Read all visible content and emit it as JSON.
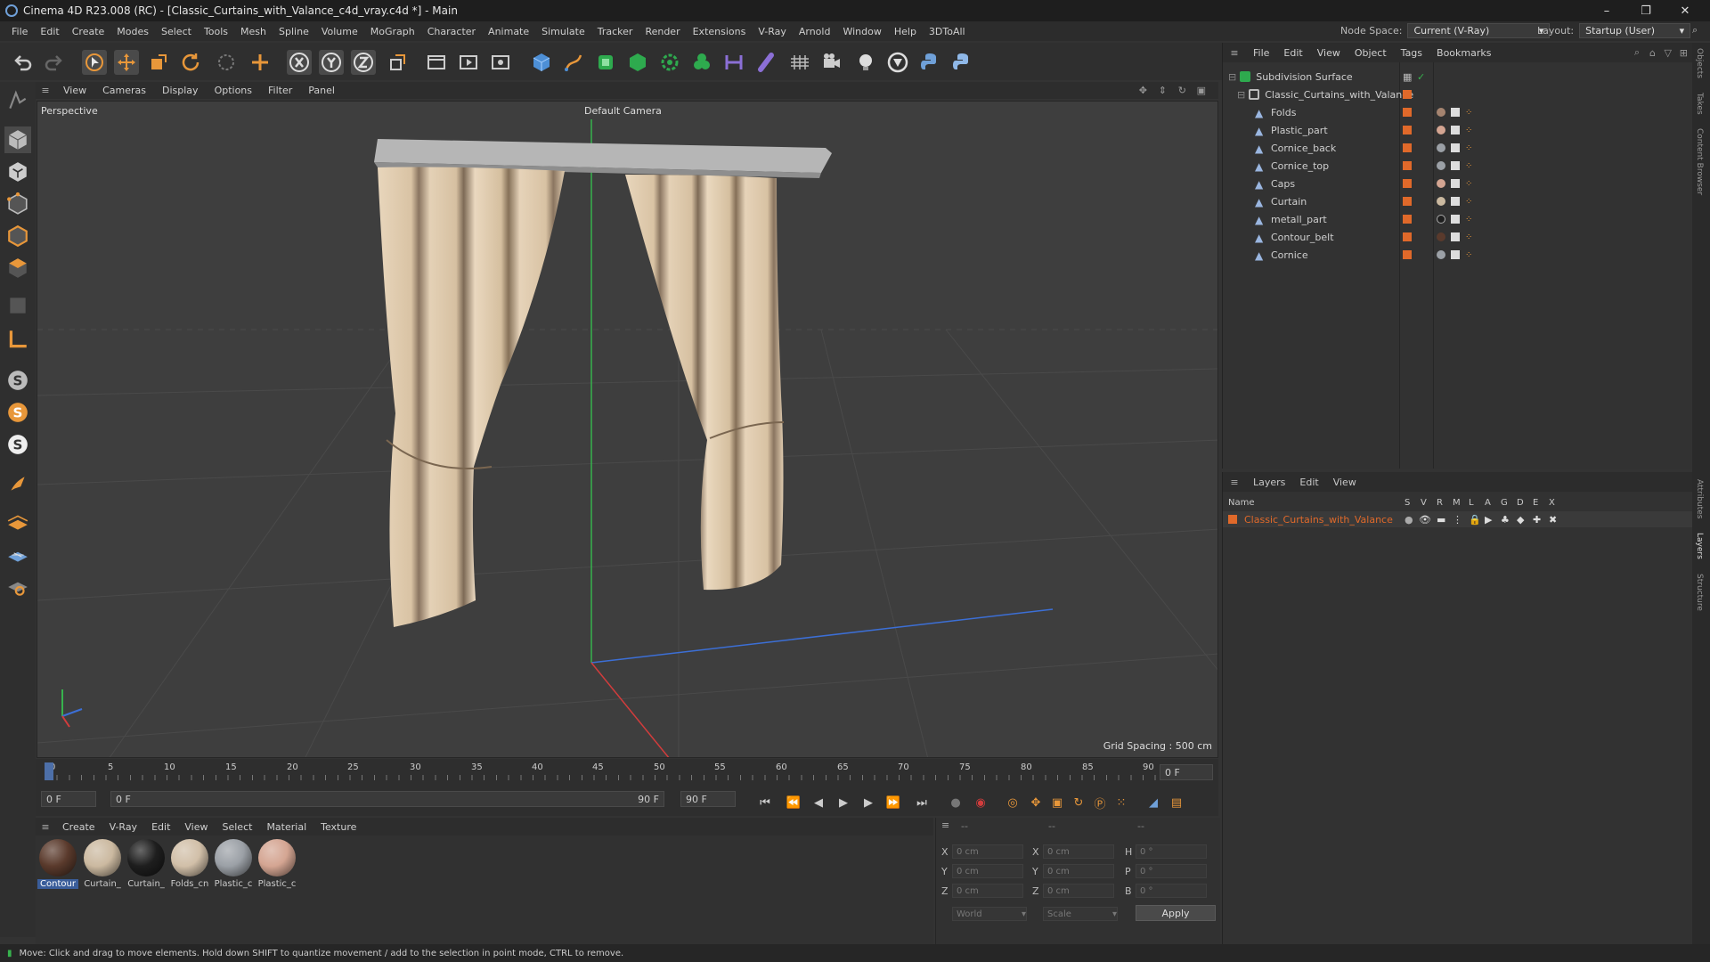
{
  "window": {
    "title": "Cinema 4D R23.008 (RC) - [Classic_Curtains_with_Valance_c4d_vray.c4d *] - Main",
    "controls": [
      "–",
      "❐",
      "✕"
    ]
  },
  "menubar": {
    "items": [
      "File",
      "Edit",
      "Create",
      "Modes",
      "Select",
      "Tools",
      "Mesh",
      "Spline",
      "Volume",
      "MoGraph",
      "Character",
      "Animate",
      "Simulate",
      "Tracker",
      "Render",
      "Extensions",
      "V-Ray",
      "Arnold",
      "Window",
      "Help",
      "3DToAll"
    ],
    "node_space_label": "Node Space:",
    "node_space_value": "Current (V-Ray)",
    "layout_label": "Layout:",
    "layout_value": "Startup (User)"
  },
  "viewport": {
    "menu": [
      "View",
      "Cameras",
      "Display",
      "Options",
      "Filter",
      "Panel"
    ],
    "view_name": "Perspective",
    "camera": "Default Camera",
    "grid_spacing": "Grid Spacing : 500 cm"
  },
  "timeline": {
    "ticks": [
      "0",
      "5",
      "10",
      "15",
      "20",
      "25",
      "30",
      "35",
      "40",
      "45",
      "50",
      "55",
      "60",
      "65",
      "70",
      "75",
      "80",
      "85",
      "90"
    ],
    "current_frame_right": "0 F",
    "start_field": "0 F",
    "range_start": "0 F",
    "range_end": "90 F",
    "end_field": "90 F"
  },
  "material_manager": {
    "menu": [
      "Create",
      "V-Ray",
      "Edit",
      "View",
      "Select",
      "Material",
      "Texture"
    ],
    "materials": [
      {
        "label": "Contour",
        "color": "#5a3a2c"
      },
      {
        "label": "Curtain_",
        "color": "#cbb9a0"
      },
      {
        "label": "Curtain_",
        "color": "#1e1e1e"
      },
      {
        "label": "Folds_cn",
        "color": "#d1bfa8"
      },
      {
        "label": "Plastic_c",
        "color": "#9ba0a6"
      },
      {
        "label": "Plastic_c",
        "color": "#d4a592"
      }
    ]
  },
  "coordinates": {
    "header_left": "--",
    "header_mid": "--",
    "header_right": "--",
    "rows": [
      {
        "a": "X",
        "av": "0 cm",
        "b": "X",
        "bv": "0 cm",
        "c": "H",
        "cv": "0 °"
      },
      {
        "a": "Y",
        "av": "0 cm",
        "b": "Y",
        "bv": "0 cm",
        "c": "P",
        "cv": "0 °"
      },
      {
        "a": "Z",
        "av": "0 cm",
        "b": "Z",
        "bv": "0 cm",
        "c": "B",
        "cv": "0 °"
      }
    ],
    "mode1": "World",
    "mode2": "Scale",
    "apply": "Apply"
  },
  "object_manager": {
    "menu": [
      "File",
      "Edit",
      "View",
      "Object",
      "Tags",
      "Bookmarks"
    ],
    "root": "Subdivision Surface",
    "group": "Classic_Curtains_with_Valance",
    "children": [
      "Folds",
      "Plastic_part",
      "Cornice_back",
      "Cornice_top",
      "Caps",
      "Curtain",
      "metall_part",
      "Contour_belt",
      "Cornice"
    ]
  },
  "layer_manager": {
    "menu": [
      "Layers",
      "Edit",
      "View"
    ],
    "col_name": "Name",
    "flags": [
      "S",
      "V",
      "R",
      "M",
      "L",
      "A",
      "G",
      "D",
      "E",
      "X"
    ],
    "layer": "Classic_Curtains_with_Valance",
    "layer_color": "#e0692a"
  },
  "right_tabs": [
    "Objects",
    "Takes",
    "Content Browser",
    "Attributes",
    "Layers",
    "Structure"
  ],
  "status": "Move: Click and drag to move elements. Hold down SHIFT to quantize movement / add to the selection in point mode, CTRL to remove."
}
